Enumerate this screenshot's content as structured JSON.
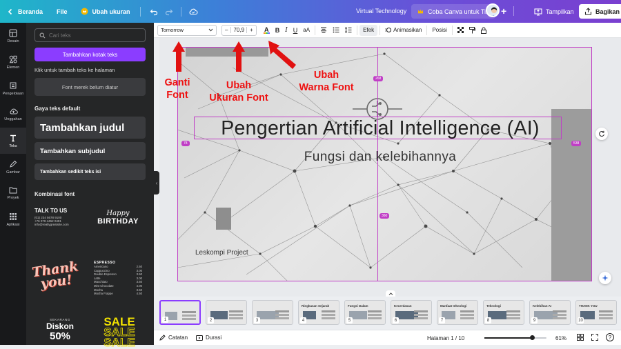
{
  "topbar": {
    "home_label": "Beranda",
    "file_label": "File",
    "resize_label": "Ubah ukuran",
    "doc_title": "Virtual Technology",
    "team_label": "Coba Canva untuk Tim",
    "present_label": "Tampilkan",
    "share_label": "Bagikan"
  },
  "rail": {
    "items": [
      {
        "label": "Desain",
        "icon": "layout-icon"
      },
      {
        "label": "Elemen",
        "icon": "shapes-icon"
      },
      {
        "label": "Pengelolaan",
        "icon": "brand-icon"
      },
      {
        "label": "Unggahan",
        "icon": "upload-icon"
      },
      {
        "label": "Teks",
        "icon": "text-icon"
      },
      {
        "label": "Gambar",
        "icon": "draw-icon"
      },
      {
        "label": "Proyek",
        "icon": "folder-icon"
      },
      {
        "label": "Aplikasi",
        "icon": "apps-icon"
      }
    ]
  },
  "panel": {
    "search_placeholder": "Cari teks",
    "add_textbox": "Tambahkan kotak teks",
    "hint": "Klik untuk tambah teks ke halaman",
    "brand_fonts": "Font merek belum diatur",
    "default_styles_title": "Gaya teks default",
    "heading": "Tambahkan judul",
    "subheading": "Tambahkan subjudul",
    "body": "Tambahkan sedikit teks isi",
    "combos_title": "Kombinasi font",
    "combos": {
      "talk": "TALK TO US",
      "talk_lines": [
        "(01) 234 5678 9100",
        "+76 079 4452 0491",
        "info@reallygreatsite.com"
      ],
      "happy": "Happy",
      "birthday": "BIRTHDAY",
      "thank": "Thank",
      "you": "you!",
      "espresso_title": "ESPRESSO",
      "menu_items": [
        "Americano",
        "Cappuccino",
        "Double Espresso",
        "Latte",
        "Macchiato",
        "Mint Chocolate",
        "Mocha",
        "Mocha Frappe"
      ],
      "menu_prices": [
        "2.50",
        "3.00",
        "3.50",
        "3.00",
        "3.50",
        "4.00",
        "3.50",
        "4.50"
      ],
      "diskon_top": "SEKARANG",
      "diskon": "Diskon",
      "diskon_value": "50%",
      "sale": "SALE"
    }
  },
  "toolbar": {
    "font_name": "Tomorrow",
    "font_size": "70,9",
    "effects": "Efek",
    "animate": "Animasikan",
    "position": "Posisi"
  },
  "slide": {
    "title": "Pengertian Artificial Intelligence (AI)",
    "subtitle": "Fungsi dan kelebihannya",
    "footer_text": "Leskompi Project",
    "guides": {
      "top": "268",
      "left": "78",
      "right": "538",
      "bottom": "360"
    }
  },
  "annotations": {
    "font": [
      "Ganti",
      "Font"
    ],
    "size": [
      "Ubah",
      "Ukuran Font"
    ],
    "color": [
      "Ubah",
      "Warna Font"
    ]
  },
  "filmstrip": {
    "pages": [
      "1",
      "2",
      "3",
      "4",
      "5",
      "6",
      "7",
      "8",
      "9",
      "10"
    ],
    "thumb_texts": [
      "",
      "",
      "",
      "Ringkasan Sejarah",
      "Fungsi Dalam",
      "Kecerdasan",
      "Manfaat teknologi",
      "Teknologi",
      "Kelebihan AI",
      "THANK YOU"
    ]
  },
  "footer": {
    "notes_label": "Catatan",
    "duration_label": "Durasi",
    "page_indicator": "Halaman 1 / 10",
    "zoom": "61%",
    "zoom_level": 0.61
  },
  "colors": {
    "accent": "#8b3dff",
    "selection": "#c03ec6",
    "annotation": "#e11111"
  }
}
